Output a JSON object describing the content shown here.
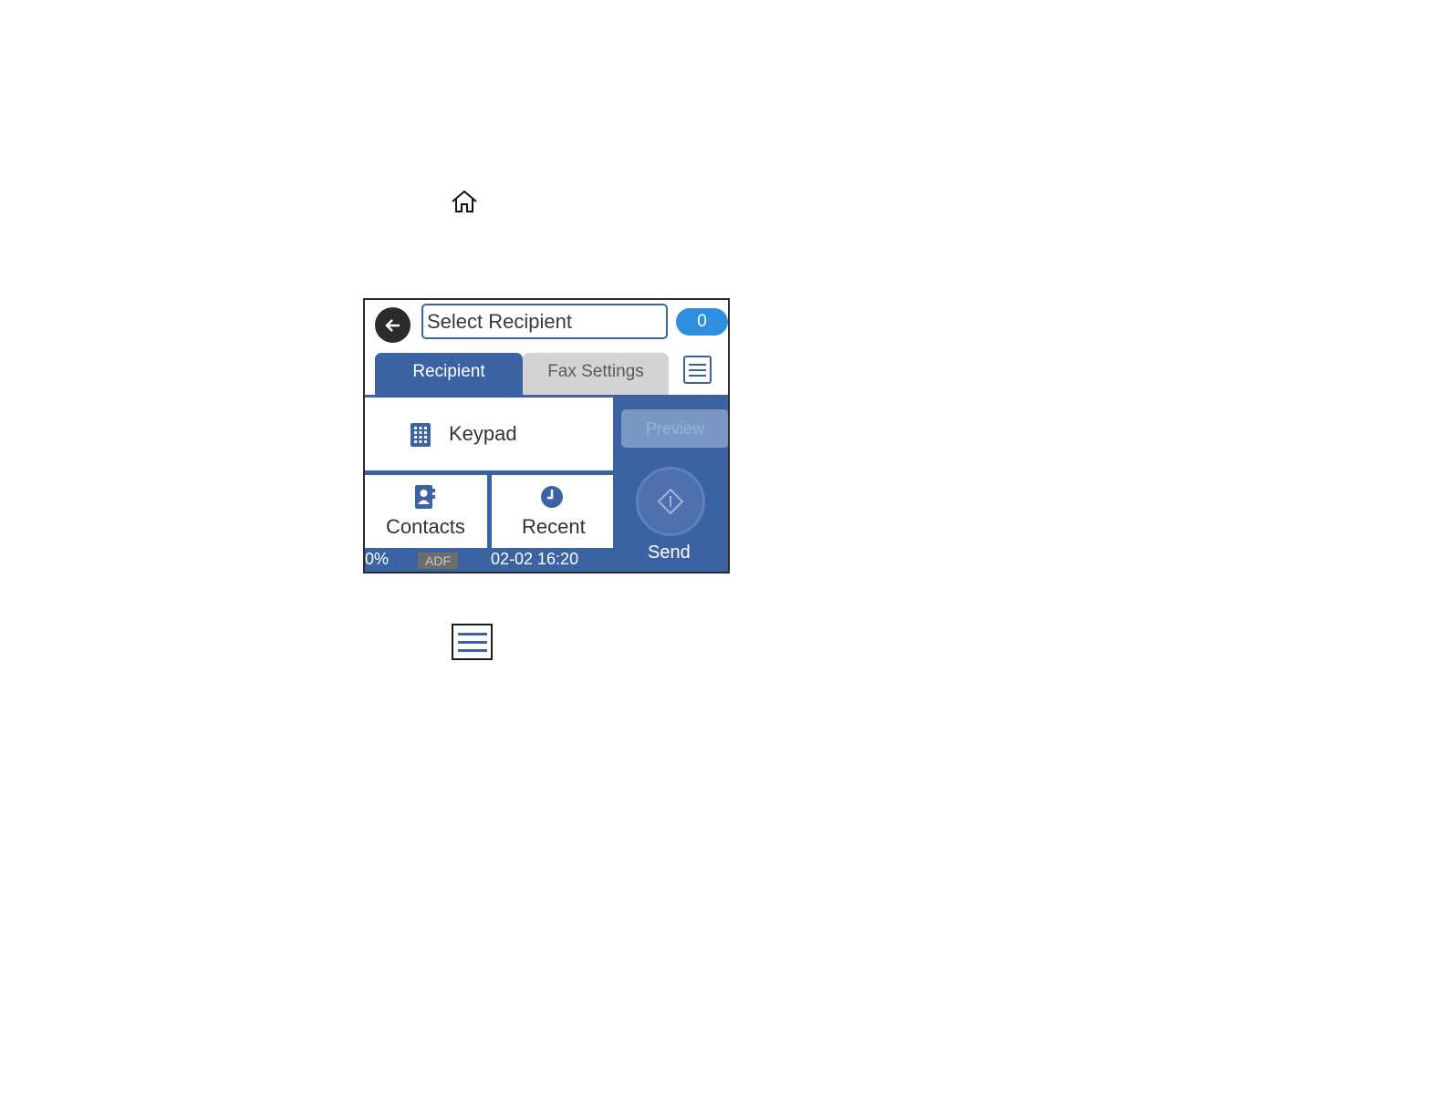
{
  "icons": {
    "home": "home-icon",
    "menu": "menu-icon"
  },
  "screen": {
    "header": {
      "back_icon": "back-arrow-icon",
      "recipient_field_text": "Select Recipient",
      "recipient_count": "0"
    },
    "tabs": [
      {
        "label": "Recipient",
        "active": true
      },
      {
        "label": "Fax Settings",
        "active": false
      }
    ],
    "menu_icon": "menu-icon",
    "tiles": {
      "keypad": {
        "label": "Keypad",
        "icon": "keypad-icon"
      },
      "contacts": {
        "label": "Contacts",
        "icon": "contacts-icon"
      },
      "recent": {
        "label": "Recent",
        "icon": "clock-icon"
      }
    },
    "preview_label": "Preview",
    "send_label": "Send",
    "status": {
      "progress": "0%",
      "source": "ADF",
      "datetime": "02-02 16:20"
    },
    "colors": {
      "primary_blue": "#3b63a3",
      "badge_blue": "#2e8fe0",
      "inactive_tab": "#d3d3d3"
    }
  }
}
